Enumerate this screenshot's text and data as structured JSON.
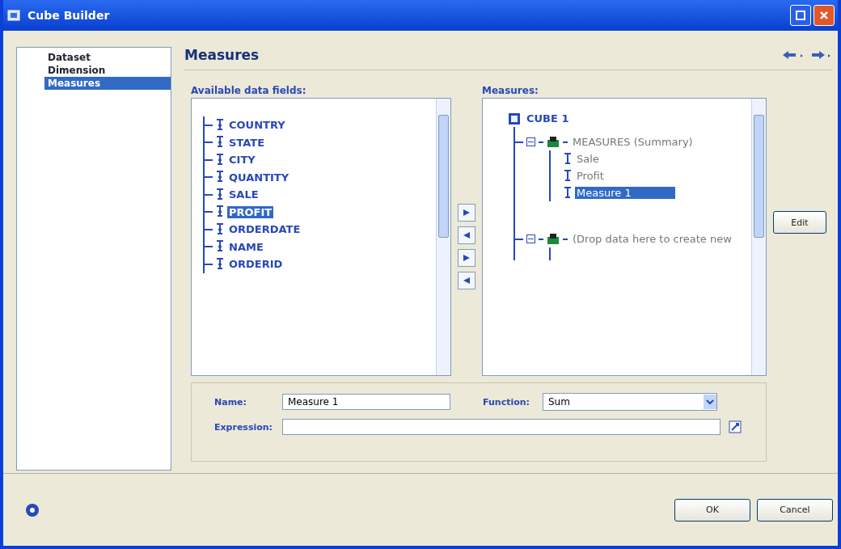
{
  "window": {
    "title": "Cube Builder"
  },
  "nav": [
    {
      "label": "Dataset",
      "selected": false
    },
    {
      "label": "Dimension",
      "selected": false
    },
    {
      "label": "Measures",
      "selected": true
    }
  ],
  "page_title": "Measures",
  "available": {
    "label": "Available data fields:",
    "fields": [
      {
        "name": "COUNTRY",
        "selected": false
      },
      {
        "name": "STATE",
        "selected": false
      },
      {
        "name": "CITY",
        "selected": false
      },
      {
        "name": "QUANTITY",
        "selected": false
      },
      {
        "name": "SALE",
        "selected": false
      },
      {
        "name": "PROFIT",
        "selected": true
      },
      {
        "name": "ORDERDATE",
        "selected": false
      },
      {
        "name": "NAME",
        "selected": false
      },
      {
        "name": "ORDERID",
        "selected": false
      }
    ]
  },
  "measures": {
    "label": "Measures:",
    "cube": "CUBE 1",
    "groups": [
      {
        "name": "MEASURES (Summary)",
        "expanded": true,
        "children": [
          {
            "name": "Sale",
            "selected": false
          },
          {
            "name": "Profit",
            "selected": false
          },
          {
            "name": "Measure 1",
            "selected": true
          }
        ]
      },
      {
        "name": "(Drop data here to create new",
        "expanded": true
      }
    ]
  },
  "edit_button": "Edit",
  "properties": {
    "name_label": "Name:",
    "name_value": "Measure 1",
    "function_label": "Function:",
    "function_value": "Sum",
    "expression_label": "Expression:"
  },
  "buttons": [
    "OK",
    "Cancel"
  ]
}
